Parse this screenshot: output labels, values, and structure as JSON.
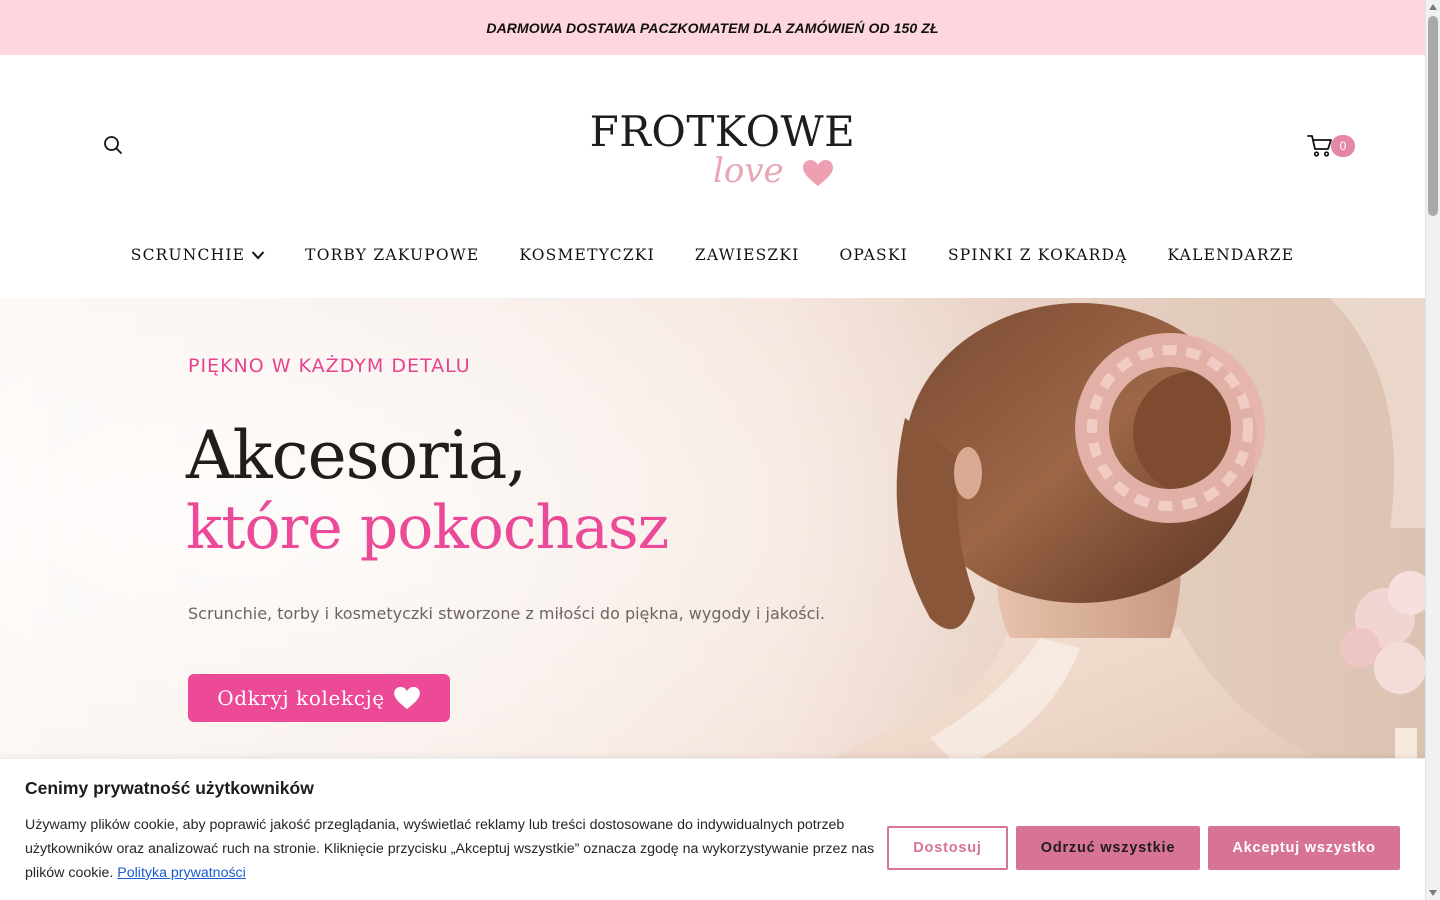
{
  "announcement": {
    "text": "DARMOWA DOSTAWA PACZKOMATEM DLA ZAMÓWIEŃ OD 150 ZŁ"
  },
  "header": {
    "logo_top": "FROTKOWE",
    "logo_bottom": "love",
    "cart_count": "0",
    "icons": {
      "search": "search-icon",
      "cart": "cart-icon",
      "logo_heart": "heart-icon"
    }
  },
  "nav": {
    "items": [
      {
        "label": "SCRUNCHIE",
        "has_dropdown": true
      },
      {
        "label": "TORBY ZAKUPOWE"
      },
      {
        "label": "KOSMETYCZKI"
      },
      {
        "label": "ZAWIESZKI"
      },
      {
        "label": "OPASKI"
      },
      {
        "label": "SPINKI Z KOKARDĄ"
      },
      {
        "label": "KALENDARZE"
      }
    ]
  },
  "hero": {
    "kicker": "PIĘKNO W KAŻDYM DETALU",
    "title_line1": "Akcesoria,",
    "title_line2": "które pokochasz",
    "subtitle": "Scrunchie, torby i kosmetyczki stworzone z miłości do piękna, wygody i jakości.",
    "cta_label": "Odkryj kolekcję"
  },
  "cookie": {
    "title": "Cenimy prywatność użytkowników",
    "text": "Używamy plików cookie, aby poprawić jakość przeglądania, wyświetlać reklamy lub treści dostosowane do indywidualnych potrzeb użytkowników oraz analizować ruch na stronie. Kliknięcie przycisku „Akceptuj wszystkie” oznacza zgodę na wykorzystywanie przez nas plików cookie.",
    "policy_link": "Polityka prywatności",
    "btn_customize": "Dostosuj",
    "btn_reject": "Odrzuć wszystkie",
    "btn_accept": "Akceptuj wszystko"
  },
  "colors": {
    "announcement_bg": "#fdd6de",
    "accent_pink": "#ec4a97",
    "cookie_button": "#d87398",
    "badge": "#e486a7"
  }
}
